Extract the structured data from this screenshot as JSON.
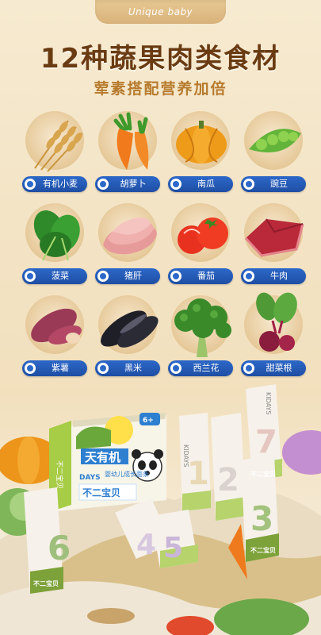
{
  "brand_tab": "Unique baby",
  "title": "12种蔬果肉类食材",
  "subtitle": "荤素搭配营养加倍",
  "ingredients": [
    {
      "label": "有机小麦",
      "icon": "wheat-icon"
    },
    {
      "label": "胡萝卜",
      "icon": "carrot-icon"
    },
    {
      "label": "南瓜",
      "icon": "pumpkin-icon"
    },
    {
      "label": "豌豆",
      "icon": "pea-icon"
    },
    {
      "label": "菠菜",
      "icon": "spinach-icon"
    },
    {
      "label": "猪肝",
      "icon": "pork-liver-icon"
    },
    {
      "label": "番茄",
      "icon": "tomato-icon"
    },
    {
      "label": "牛肉",
      "icon": "beef-icon"
    },
    {
      "label": "紫薯",
      "icon": "purple-sweet-potato-icon"
    },
    {
      "label": "黑米",
      "icon": "black-rice-icon"
    },
    {
      "label": "西兰花",
      "icon": "broccoli-icon"
    },
    {
      "label": "甜菜根",
      "icon": "beetroot-icon"
    }
  ],
  "product": {
    "box_title": "天有机",
    "box_subtitle": "婴幼儿成长面条",
    "box_brand_line": "DAYS",
    "box_bottom": "不二宝贝",
    "box_side": "不二宝贝",
    "box_badge": "6+",
    "pack_brand": "KIDAYS",
    "pack_bottom": "不二宝贝",
    "pack_numbers": [
      "6",
      "1",
      "2",
      "7",
      "3",
      "4",
      "5"
    ]
  },
  "colors": {
    "title": "#6a3b12",
    "subtitle": "#b77b2e",
    "label_bg": "#2c68c9",
    "background": "#f3e3c4"
  }
}
